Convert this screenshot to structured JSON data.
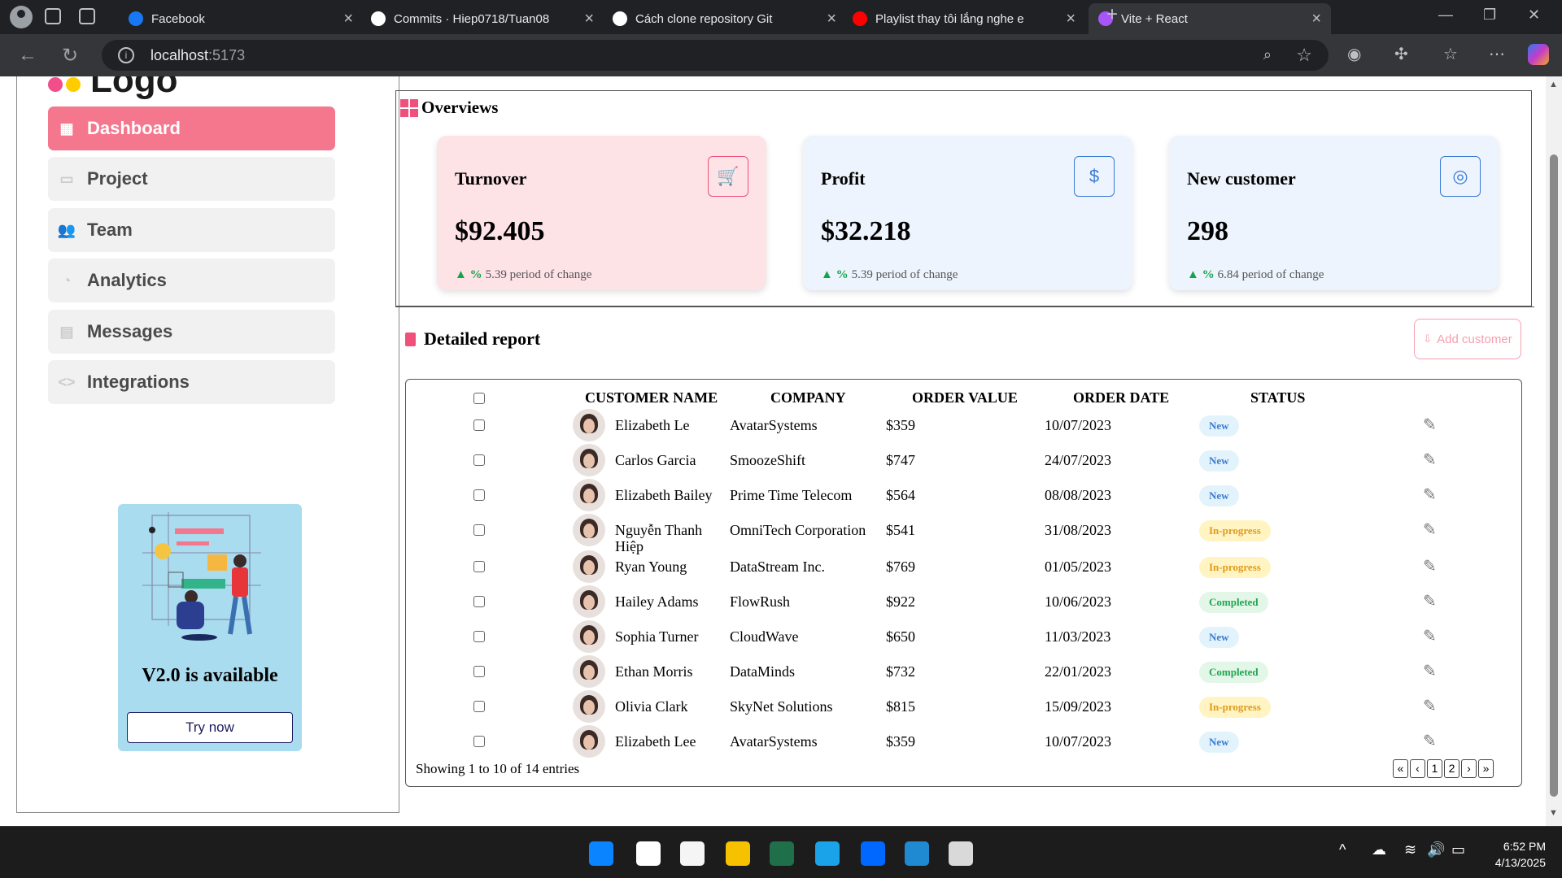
{
  "browser": {
    "tabs": [
      {
        "title": "Facebook",
        "color": "#1877f2"
      },
      {
        "title": "Commits · Hiep0718/Tuan08",
        "color": "#ffffff"
      },
      {
        "title": "Cách clone repository Git",
        "color": "#ffffff"
      },
      {
        "title": "Playlist thay tôi lắng nghe e",
        "color": "#ff0000"
      },
      {
        "title": "Vite + React",
        "color": "#a855f7"
      }
    ],
    "url_host": "localhost",
    "url_port": ":5173"
  },
  "sidebar": {
    "logo": "Logo",
    "items": [
      {
        "label": "Dashboard",
        "icon": "grid-icon",
        "glyph": "▦"
      },
      {
        "label": "Project",
        "icon": "folder-icon",
        "glyph": "▭"
      },
      {
        "label": "Team",
        "icon": "users-icon",
        "glyph": "👥"
      },
      {
        "label": "Analytics",
        "icon": "pie-chart-icon",
        "glyph": "◔"
      },
      {
        "label": "Messages",
        "icon": "message-icon",
        "glyph": "▤"
      },
      {
        "label": "Integrations",
        "icon": "code-icon",
        "glyph": "<>"
      }
    ],
    "promo": {
      "title": "V2.0 is available",
      "button": "Try now"
    }
  },
  "overview": {
    "title": "Overviews",
    "cards": [
      {
        "label": "Turnover",
        "value": "$92.405",
        "arrow": "▲ %",
        "change": "5.39 period of change",
        "bg": "#fde2e6",
        "accent": "#f0517a",
        "icon": "cart-icon",
        "glyph": "🛒"
      },
      {
        "label": "Profit",
        "value": "$32.218",
        "arrow": "▲ %",
        "change": "5.39 period of change",
        "bg": "#edf4fd",
        "accent": "#3a7bd5",
        "icon": "dollar-icon",
        "glyph": "$"
      },
      {
        "label": "New customer",
        "value": "298",
        "arrow": "▲ %",
        "change": "6.84 period of change",
        "bg": "#edf4fd",
        "accent": "#3a7bd5",
        "icon": "user-circle-icon",
        "glyph": "◎"
      }
    ]
  },
  "report": {
    "title": "Detailed report",
    "add_button": "Add customer",
    "headers": [
      "CUSTOMER NAME",
      "COMPANY",
      "ORDER VALUE",
      "ORDER DATE",
      "STATUS"
    ],
    "rows": [
      {
        "name": "Elizabeth Le",
        "company": "AvatarSystems",
        "value": "$359",
        "date": "10/07/2023",
        "status": "New"
      },
      {
        "name": "Carlos Garcia",
        "company": "SmoozeShift",
        "value": "$747",
        "date": "24/07/2023",
        "status": "New"
      },
      {
        "name": "Elizabeth Bailey",
        "company": "Prime Time Telecom",
        "value": "$564",
        "date": "08/08/2023",
        "status": "New"
      },
      {
        "name": "Nguyễn Thanh Hiệp",
        "company": "OmniTech Corporation",
        "value": "$541",
        "date": "31/08/2023",
        "status": "In-progress"
      },
      {
        "name": "Ryan Young",
        "company": "DataStream Inc.",
        "value": "$769",
        "date": "01/05/2023",
        "status": "In-progress"
      },
      {
        "name": "Hailey Adams",
        "company": "FlowRush",
        "value": "$922",
        "date": "10/06/2023",
        "status": "Completed"
      },
      {
        "name": "Sophia Turner",
        "company": "CloudWave",
        "value": "$650",
        "date": "11/03/2023",
        "status": "New"
      },
      {
        "name": "Ethan Morris",
        "company": "DataMinds",
        "value": "$732",
        "date": "22/01/2023",
        "status": "Completed"
      },
      {
        "name": "Olivia Clark",
        "company": "SkyNet Solutions",
        "value": "$815",
        "date": "15/09/2023",
        "status": "In-progress"
      },
      {
        "name": "Elizabeth Lee",
        "company": "AvatarSystems",
        "value": "$359",
        "date": "10/07/2023",
        "status": "New"
      }
    ],
    "showing": "Showing 1 to 10 of 14 entries",
    "pages": [
      "«",
      "‹",
      "1",
      "2",
      "›",
      "»"
    ]
  },
  "taskbar": {
    "time": "6:52 PM",
    "date": "4/13/2025",
    "apps": [
      {
        "name": "windows-start-icon",
        "color": "#0a84ff"
      },
      {
        "name": "search-icon",
        "color": "#ffffff"
      },
      {
        "name": "store-icon",
        "color": "#f5f5f5"
      },
      {
        "name": "file-explorer-icon",
        "color": "#f6c200"
      },
      {
        "name": "app-green-icon",
        "color": "#1f6f4a"
      },
      {
        "name": "edge-icon",
        "color": "#1aa3e8"
      },
      {
        "name": "zalo-icon",
        "color": "#0068ff"
      },
      {
        "name": "vscode-icon",
        "color": "#1f8ad2"
      },
      {
        "name": "snipping-icon",
        "color": "#d9d9d9"
      }
    ]
  }
}
